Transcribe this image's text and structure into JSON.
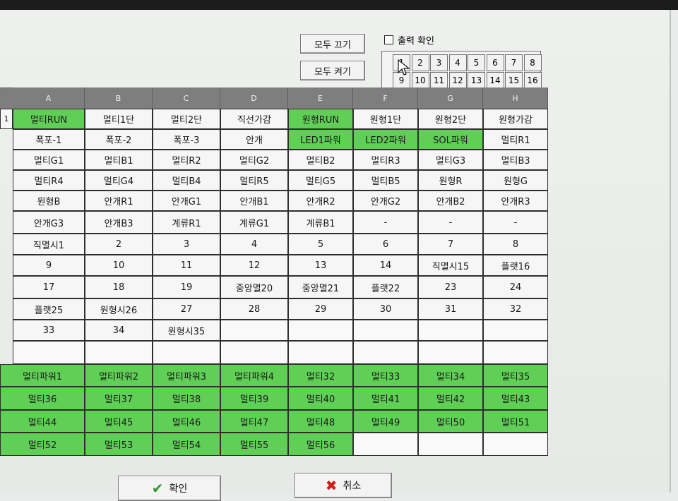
{
  "controls": {
    "all_off_label": "모두 끄기",
    "all_on_label": "모두 켜기",
    "output_check_label": "출력 확인",
    "number_grid": [
      "1",
      "2",
      "3",
      "4",
      "5",
      "6",
      "7",
      "8",
      "9",
      "10",
      "11",
      "12",
      "13",
      "14",
      "15",
      "16"
    ]
  },
  "table": {
    "columns": [
      "A",
      "B",
      "C",
      "D",
      "E",
      "F",
      "G",
      "H"
    ],
    "row_labels": [
      "1"
    ],
    "rows": [
      [
        "멀티RUN",
        "멀티1단",
        "멀티2단",
        "직선가감",
        "원형RUN",
        "원형1단",
        "원형2단",
        "원형가감"
      ],
      [
        "폭포-1",
        "폭포-2",
        "폭포-3",
        "안개",
        "LED1파워",
        "LED2파워",
        "SOL파워",
        "멀티R1"
      ],
      [
        "멀티G1",
        "멀티B1",
        "멀티R2",
        "멀티G2",
        "멀티B2",
        "멀티R3",
        "멀티G3",
        "멀티B3"
      ],
      [
        "멀티R4",
        "멀티G4",
        "멀티B4",
        "멀티R5",
        "멀티G5",
        "멀티B5",
        "원형R",
        "원형G"
      ],
      [
        "원형B",
        "안개R1",
        "안개G1",
        "안개B1",
        "안개R2",
        "안개G2",
        "안개B2",
        "안개R3"
      ],
      [
        "안개G3",
        "안개B3",
        "계류R1",
        "계류G1",
        "계류B1",
        "-",
        "-",
        "-"
      ],
      [
        "직멸시1",
        "2",
        "3",
        "4",
        "5",
        "6",
        "7",
        "8"
      ],
      [
        "9",
        "10",
        "11",
        "12",
        "13",
        "14",
        "직멸시15",
        "플랫16"
      ],
      [
        "17",
        "18",
        "19",
        "중앙멸20",
        "중앙멸21",
        "플랫22",
        "23",
        "24"
      ],
      [
        "플랫25",
        "원형시26",
        "27",
        "28",
        "29",
        "30",
        "31",
        "32"
      ],
      [
        "33",
        "34",
        "원형시35",
        "",
        "",
        "",
        "",
        ""
      ],
      [
        "",
        "",
        "",
        "",
        "",
        "",
        "",
        ""
      ],
      [
        "멀티파워1",
        "멀티파워2",
        "멀티파워3",
        "멀티파워4",
        "멀티32",
        "멀티33",
        "멀티34",
        "멀티35"
      ],
      [
        "멀티36",
        "멀티37",
        "멀티38",
        "멀티39",
        "멀티40",
        "멀티41",
        "멀티42",
        "멀티43"
      ],
      [
        "멀티44",
        "멀티45",
        "멀티46",
        "멀티47",
        "멀티48",
        "멀티49",
        "멀티50",
        "멀티51"
      ],
      [
        "멀티52",
        "멀티53",
        "멀티54",
        "멀티55",
        "멀티56",
        "",
        "",
        ""
      ]
    ],
    "green_cells": [
      [
        0,
        0
      ],
      [
        0,
        4
      ],
      [
        1,
        4
      ],
      [
        1,
        5
      ],
      [
        1,
        6
      ]
    ],
    "green_rows_from": 12,
    "green_last_row_count": 5
  },
  "footer": {
    "ok_label": "확인",
    "cancel_label": "취소"
  }
}
